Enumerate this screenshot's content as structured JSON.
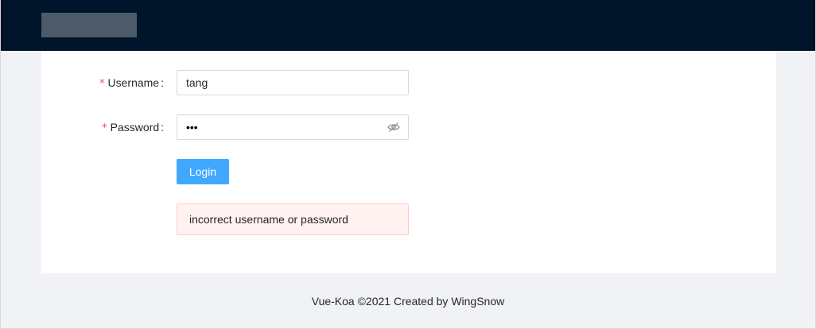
{
  "form": {
    "username": {
      "label": "Username",
      "required_mark": "*",
      "value": "tang"
    },
    "password": {
      "label": "Password",
      "required_mark": "*",
      "value": "•••",
      "toggle_icon": "eye-invisible-icon"
    },
    "login_label": "Login",
    "error_message": "incorrect username or password"
  },
  "footer": {
    "text": "Vue-Koa ©2021 Created by WingSnow"
  },
  "colors": {
    "header": "#001529",
    "primary_button": "#40a9ff",
    "error_bg": "#fff2f0",
    "error_border": "#ffccc7",
    "required": "#ff4d4f"
  }
}
